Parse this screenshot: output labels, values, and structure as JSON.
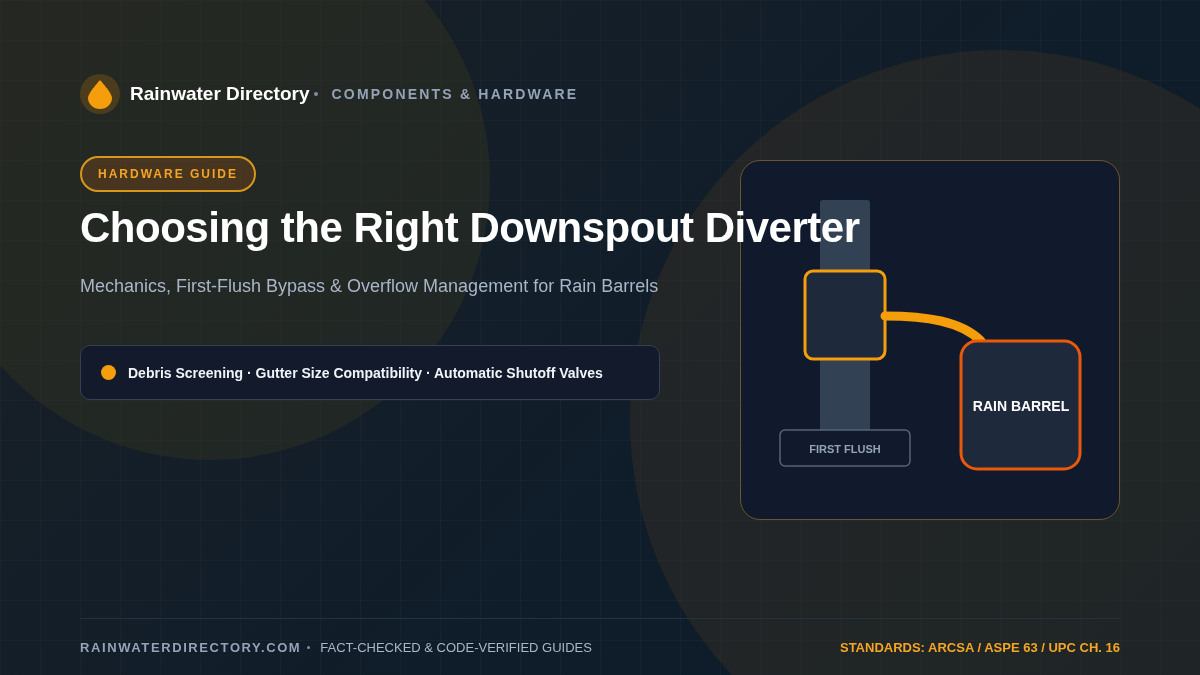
{
  "brand": {
    "name": "Rainwater Directory",
    "section": "COMPONENTS & HARDWARE"
  },
  "badge": "HARDWARE GUIDE",
  "title": "Choosing the Right Downspout Diverter",
  "subtitle": "Mechanics, First-Flush Bypass & Overflow Management for Rain Barrels",
  "features": "Debris Screening · Gutter Size Compatibility · Automatic Shutoff Valves",
  "diagram": {
    "barrel_label": "RAIN BARREL",
    "first_flush_label": "FIRST FLUSH"
  },
  "footer": {
    "site": "RAINWATERDIRECTORY.COM",
    "tagline": "FACT-CHECKED & CODE-VERIFIED GUIDES",
    "standards": "STANDARDS: ARCSA / ASPE 63 / UPC CH. 16"
  }
}
